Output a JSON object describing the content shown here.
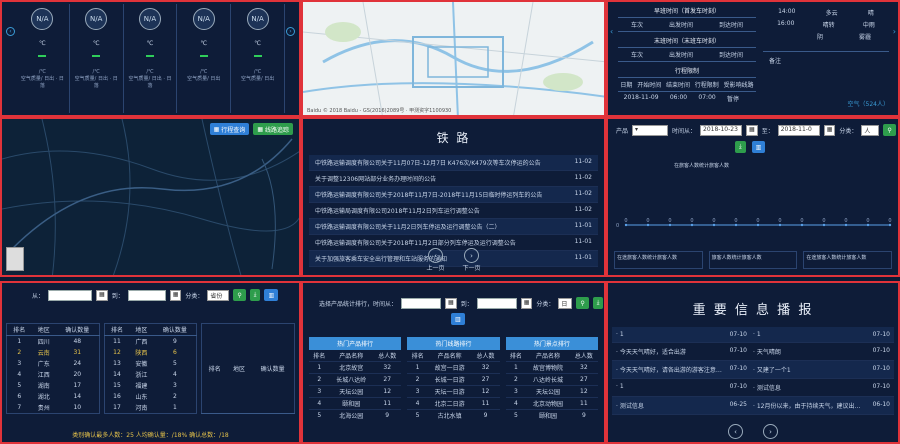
{
  "weather": {
    "cards": [
      {
        "status": "N/A",
        "temp": "℃",
        "range": "/℃",
        "label": "空气质量/ 日出 · 日落"
      },
      {
        "status": "N/A",
        "temp": "℃",
        "range": "/℃",
        "label": "空气质量/ 日出 · 日落"
      },
      {
        "status": "N/A",
        "temp": "℃",
        "range": "/℃",
        "label": "空气质量/ 日出 · 日落"
      },
      {
        "status": "N/A",
        "temp": "℃",
        "range": "/℃",
        "label": "空气质量/ 日出"
      },
      {
        "status": "N/A",
        "temp": "℃",
        "range": "/℃",
        "label": "空气质量/ 日出"
      }
    ]
  },
  "map_top": {
    "footer": "Baidu © 2018 Baidu - GS(2016)2089号 · 甲测资字1100930"
  },
  "schedule": {
    "section1": "早班时间（首发车时刻）",
    "section2": "末班时间（末班车时刻）",
    "section3": "行程限制",
    "cols": [
      "车次",
      "出发时间",
      "到达时间"
    ],
    "cols3": [
      "日期",
      "开始时间",
      "结束时间",
      "行程限制",
      "受影响线路"
    ],
    "row3": [
      "2018-11-09",
      "06:00",
      "07:00",
      "暂停",
      ""
    ],
    "side_times": [
      "14:00",
      "16:00"
    ],
    "side_values": [
      "晴",
      "中雨"
    ],
    "side_status": [
      "多云",
      "阴"
    ],
    "side_notes": [
      "晴转",
      "雾霾"
    ],
    "side_label": "备注",
    "bottom_label": "空气（524人）"
  },
  "map_large": {
    "btn_train": "行程查询",
    "btn_line": "线路追踪"
  },
  "rail": {
    "title": "铁 路",
    "prev": "上一页",
    "next": "下一页",
    "items": [
      {
        "text": "中铁路运输调度有限公司关于11月07日-12月7日 K476次/K479次等车次停运的公告",
        "date": "11-02"
      },
      {
        "text": "关于调整12306网站部分业务办理时间的公告",
        "date": "11-02"
      },
      {
        "text": "中铁路运输调度有限公司关于2018年11月7日-2018年11月15日临时停运列车的公告",
        "date": "11-02"
      },
      {
        "text": "中铁路运输局调度有限公司2018年11月2日列车运行调整公告",
        "date": "11-02"
      },
      {
        "text": "中铁路运输调度有限公司关于11月2日列车停运及运行调整公告（二）",
        "date": "11-01"
      },
      {
        "text": "中铁路运输调度有限公司关于2018年11月2日部分列车停运及运行调整公告",
        "date": "11-01"
      },
      {
        "text": "关于加强旅客乘车安全出行管理和车站服务的通知",
        "date": "11-01"
      }
    ]
  },
  "chart": {
    "label_product": "产品",
    "label_time": "时间从：",
    "label_to": "至：",
    "date_from": "2018-10-23",
    "date_to": "2018-11-0",
    "label_type": "分类：",
    "type_val": "人",
    "legend": "在旅客人数统计旅客人数",
    "footers": [
      "在途旅客人数统计旅客人数",
      "旅客人数统计旅客人数",
      "在途旅客人数统计旅客人数"
    ]
  },
  "chart_data": {
    "type": "line",
    "series": [
      {
        "name": "在旅客人数统计旅客人数",
        "values": [
          0,
          0,
          0,
          0,
          0,
          0,
          0,
          0,
          0,
          0,
          0,
          0,
          0
        ]
      }
    ],
    "ylim": [
      0,
      1
    ],
    "ytick": "0"
  },
  "ranking": {
    "label_from": "从：",
    "label_to": "到：",
    "label_type": "分类：",
    "type_val": "省份",
    "cols": [
      "排名",
      "地区",
      "确认数量"
    ],
    "col_a": [
      {
        "rank": "1",
        "name": "四川",
        "val": "48"
      },
      {
        "rank": "2",
        "name": "云南",
        "val": "31"
      },
      {
        "rank": "3",
        "name": "广东",
        "val": "24"
      },
      {
        "rank": "4",
        "name": "江西",
        "val": "20"
      },
      {
        "rank": "5",
        "name": "湖南",
        "val": "17"
      },
      {
        "rank": "6",
        "name": "湖北",
        "val": "14"
      },
      {
        "rank": "7",
        "name": "贵州",
        "val": "10"
      }
    ],
    "col_b": [
      {
        "rank": "11",
        "name": "广西",
        "val": "9"
      },
      {
        "rank": "12",
        "name": "陕西",
        "val": "6"
      },
      {
        "rank": "13",
        "name": "安徽",
        "val": "5"
      },
      {
        "rank": "14",
        "name": "浙江",
        "val": "4"
      },
      {
        "rank": "15",
        "name": "福建",
        "val": "3"
      },
      {
        "rank": "16",
        "name": "山东",
        "val": "2"
      },
      {
        "rank": "17",
        "name": "河南",
        "val": "1"
      }
    ],
    "col_c": [],
    "footer": "类别确认最多人数：25  人均确认量：/18%  确认总数：/18"
  },
  "top_lists": {
    "label": "选择产品统计排行，时间从：",
    "label_to": "到：",
    "label_type": "分类：",
    "type_val": "日",
    "tables": [
      {
        "title": "热门产品排行",
        "cols": [
          "排名",
          "产品名称",
          "总人数"
        ],
        "rows": [
          [
            "1",
            "北京故宫",
            "32"
          ],
          [
            "2",
            "长城八达岭",
            "27"
          ],
          [
            "3",
            "天坛公园",
            "12"
          ],
          [
            "4",
            "颐和园",
            "11"
          ],
          [
            "5",
            "北海公园",
            "9"
          ]
        ]
      },
      {
        "title": "热门线路排行",
        "cols": [
          "排名",
          "产品名称",
          "总人数"
        ],
        "rows": [
          [
            "1",
            "故宫一日游",
            "32"
          ],
          [
            "2",
            "长城一日游",
            "27"
          ],
          [
            "3",
            "天坛一日游",
            "12"
          ],
          [
            "4",
            "北京二日游",
            "11"
          ],
          [
            "5",
            "古北水镇",
            "9"
          ]
        ]
      },
      {
        "title": "热门景点排行",
        "cols": [
          "排名",
          "产品名称",
          "总人数"
        ],
        "rows": [
          [
            "1",
            "故宫博物院",
            "32"
          ],
          [
            "2",
            "八达岭长城",
            "27"
          ],
          [
            "3",
            "天坛公园",
            "12"
          ],
          [
            "4",
            "北京动物园",
            "11"
          ],
          [
            "5",
            "颐和园",
            "9"
          ]
        ]
      }
    ]
  },
  "info": {
    "title": "重 要 信 息 播 报",
    "rows": [
      {
        "l": "· 1",
        "ld": "07-10",
        "r": "· 1",
        "rd": "07-10"
      },
      {
        "l": "· 今天天气晴好，适合出游",
        "ld": "07-10",
        "r": "· 天气晴朗",
        "rd": "07-10"
      },
      {
        "l": "· 今天天气晴好，请各出游的游客注意交通安全",
        "ld": "07-10",
        "r": "· 又建了一个1",
        "rd": "07-10"
      },
      {
        "l": "· 1",
        "ld": "07-10",
        "r": "· 测试信息",
        "rd": "07-10"
      },
      {
        "l": "· 测试信息",
        "ld": "06-25",
        "r": "· 12月份以来，由于持续天气，建议出游客注意保暖...",
        "rd": "06-10"
      }
    ]
  }
}
